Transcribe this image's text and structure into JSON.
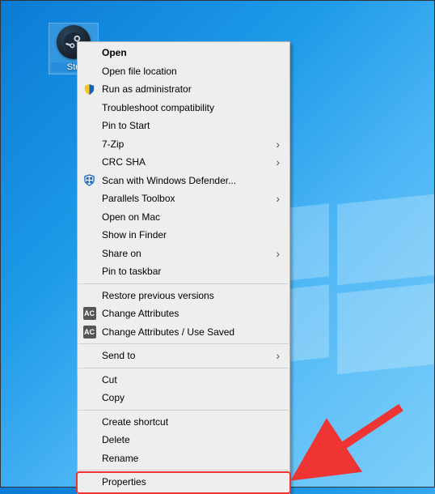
{
  "desktop": {
    "icon_label": "Ste",
    "icon_name": "steam-shortcut"
  },
  "menu": {
    "items": [
      {
        "label": "Open",
        "bold": true
      },
      {
        "label": "Open file location"
      },
      {
        "label": "Run as administrator",
        "icon": "shield-icon"
      },
      {
        "label": "Troubleshoot compatibility"
      },
      {
        "label": "Pin to Start"
      },
      {
        "label": "7-Zip",
        "submenu": true
      },
      {
        "label": "CRC SHA",
        "submenu": true
      },
      {
        "label": "Scan with Windows Defender...",
        "icon": "defender-icon"
      },
      {
        "label": "Parallels Toolbox",
        "submenu": true
      },
      {
        "label": "Open on Mac"
      },
      {
        "label": "Show in Finder"
      },
      {
        "label": "Share on",
        "submenu": true
      },
      {
        "label": "Pin to taskbar"
      },
      {
        "sep": true
      },
      {
        "label": "Restore previous versions"
      },
      {
        "label": "Change Attributes",
        "icon": "ac-icon"
      },
      {
        "label": "Change Attributes / Use Saved",
        "icon": "ac-icon"
      },
      {
        "sep": true
      },
      {
        "label": "Send to",
        "submenu": true
      },
      {
        "sep": true
      },
      {
        "label": "Cut"
      },
      {
        "label": "Copy"
      },
      {
        "sep": true
      },
      {
        "label": "Create shortcut"
      },
      {
        "label": "Delete"
      },
      {
        "label": "Rename"
      },
      {
        "sep": true
      },
      {
        "label": "Properties",
        "highlight": true
      }
    ]
  },
  "badges": {
    "ac": "AC"
  },
  "annotation": {
    "arrow_color": "#ef3434"
  }
}
